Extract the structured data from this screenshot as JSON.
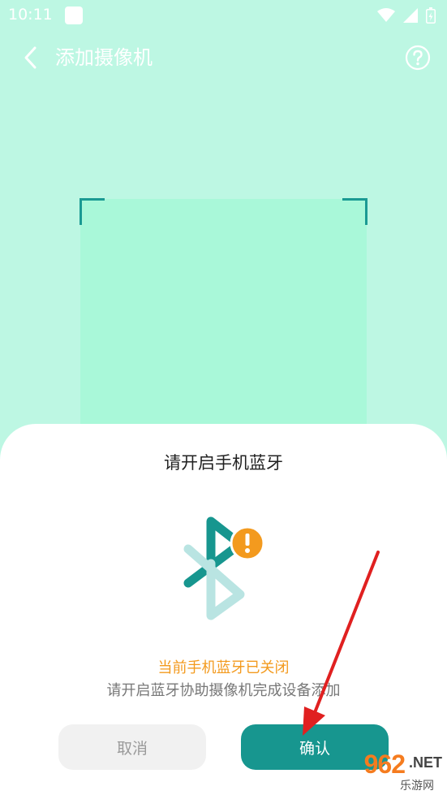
{
  "status_bar": {
    "time": "10:11"
  },
  "header": {
    "title": "添加摄像机",
    "back_icon": "chevron-left-icon",
    "help_icon": "help-circle-icon"
  },
  "dialog": {
    "title": "请开启手机蓝牙",
    "icon": "bluetooth-warning-icon",
    "warning": "当前手机蓝牙已关闭",
    "description": "请开启蓝牙协助摄像机完成设备添加",
    "cancel_label": "取消",
    "confirm_label": "确认"
  },
  "watermark": {
    "brand": "962",
    "suffix": ".NET",
    "subtitle": "乐游网"
  },
  "colors": {
    "background": "#bdf7e3",
    "accent": "#17968f",
    "warning": "#f39a1e",
    "annotation_arrow": "#e02020"
  }
}
